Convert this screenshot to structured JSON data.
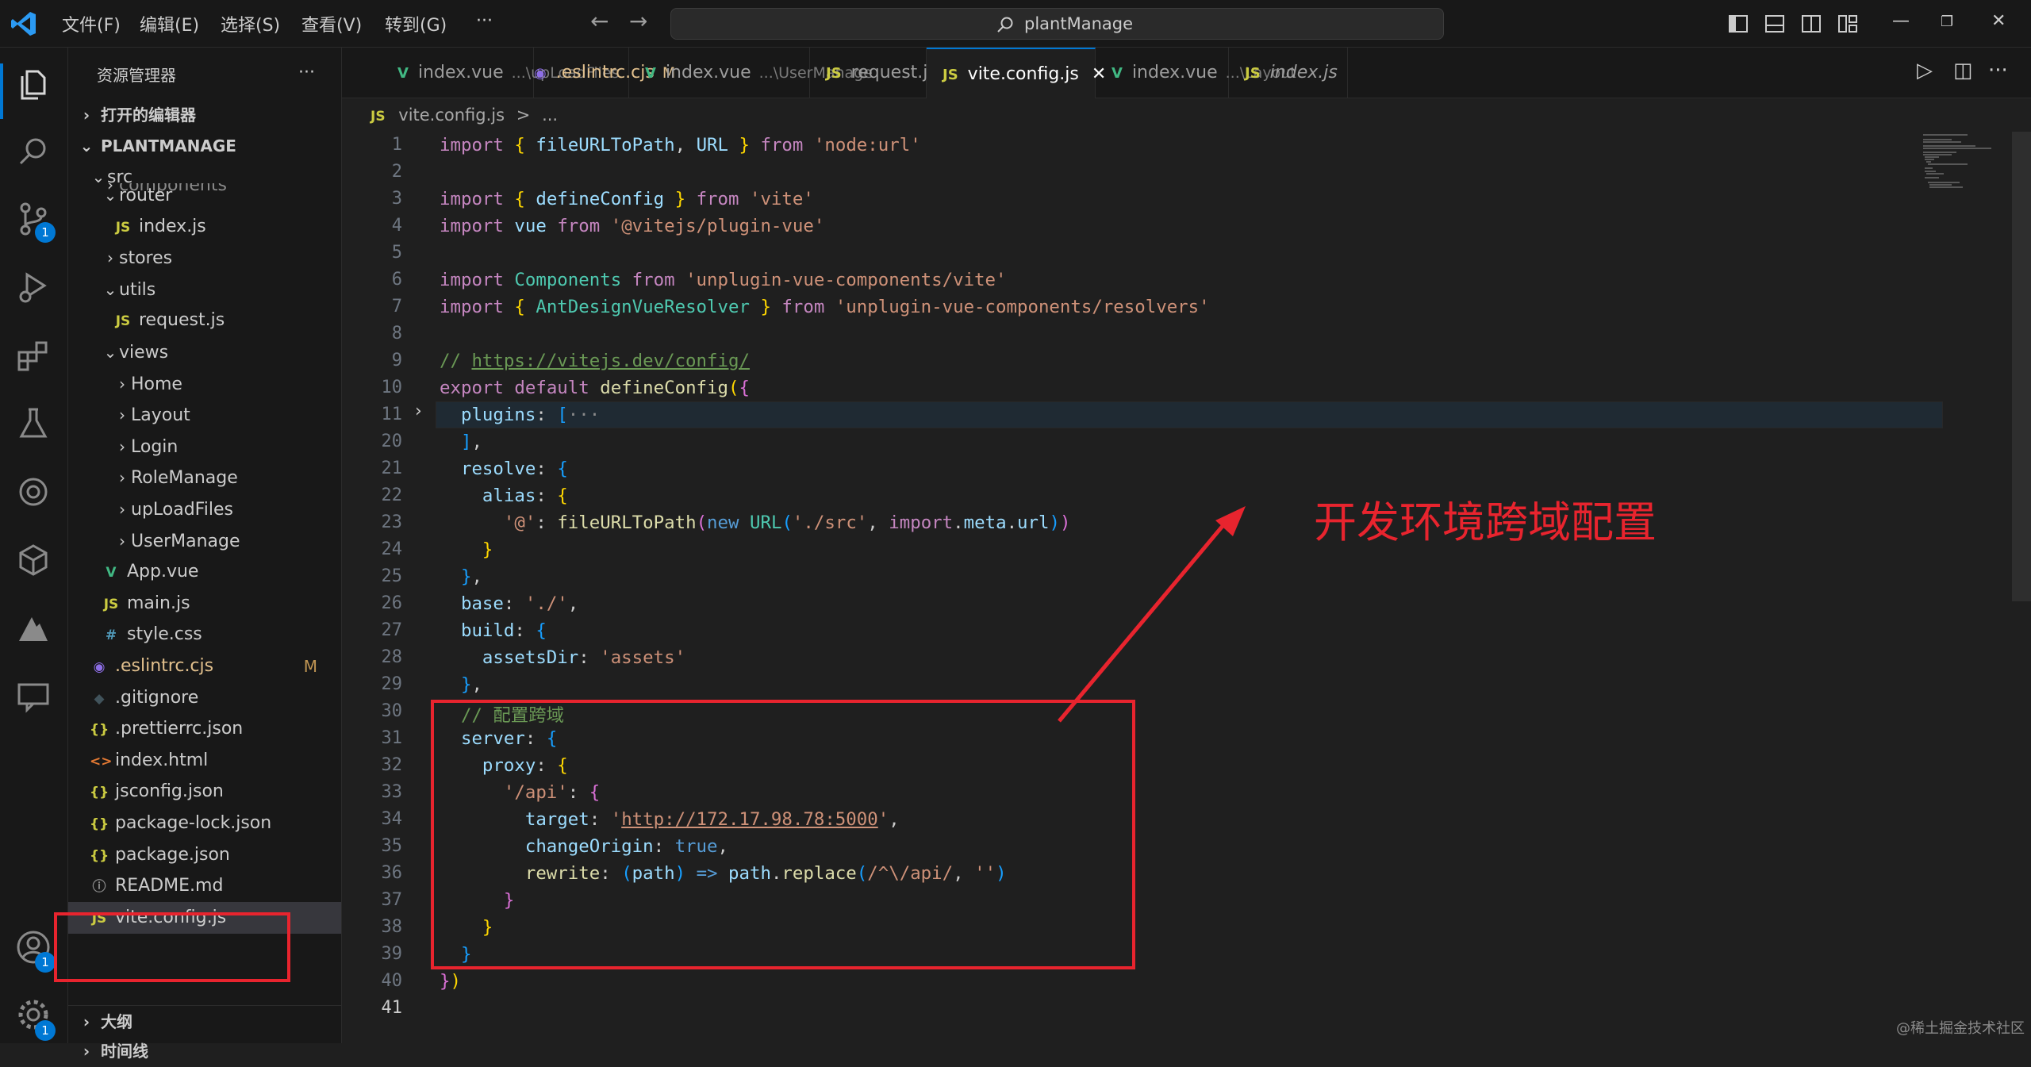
{
  "menu": {
    "items": [
      "文件(F)",
      "编辑(E)",
      "选择(S)",
      "查看(V)",
      "转到(G)"
    ],
    "more": "···"
  },
  "search": {
    "text": "plantManage"
  },
  "activity": {
    "source_control_badge": "1",
    "accounts_badge": "1",
    "settings_badge": "1"
  },
  "sidebar": {
    "title": "资源管理器",
    "more": "···",
    "open_editors": "打开的编辑器",
    "project": "PLANTMANAGE",
    "tree": [
      {
        "label": "src",
        "type": "folder-open"
      },
      {
        "label": "components",
        "type": "folder"
      },
      {
        "label": "router",
        "type": "folder-open"
      },
      {
        "label": "index.js",
        "type": "js"
      },
      {
        "label": "stores",
        "type": "folder"
      },
      {
        "label": "utils",
        "type": "folder-open"
      },
      {
        "label": "request.js",
        "type": "js"
      },
      {
        "label": "views",
        "type": "folder-open"
      },
      {
        "label": "Home",
        "type": "folder"
      },
      {
        "label": "Layout",
        "type": "folder"
      },
      {
        "label": "Login",
        "type": "folder"
      },
      {
        "label": "RoleManage",
        "type": "folder"
      },
      {
        "label": "upLoadFiles",
        "type": "folder"
      },
      {
        "label": "UserManage",
        "type": "folder"
      },
      {
        "label": "App.vue",
        "type": "vue"
      },
      {
        "label": "main.js",
        "type": "js"
      },
      {
        "label": "style.css",
        "type": "css"
      },
      {
        "label": ".eslintrc.cjs",
        "type": "eslint",
        "status": "M"
      },
      {
        "label": ".gitignore",
        "type": "git"
      },
      {
        "label": ".prettierrc.json",
        "type": "json"
      },
      {
        "label": "index.html",
        "type": "html"
      },
      {
        "label": "jsconfig.json",
        "type": "json"
      },
      {
        "label": "package-lock.json",
        "type": "json"
      },
      {
        "label": "package.json",
        "type": "json"
      },
      {
        "label": "README.md",
        "type": "info"
      },
      {
        "label": "vite.config.js",
        "type": "js"
      }
    ],
    "outline": "大纲",
    "timeline": "时间线"
  },
  "tabs": [
    {
      "label": "index.vue",
      "hint": "...\\upLoadFiles",
      "type": "vue"
    },
    {
      "label": ".eslintrc.cjs",
      "hint": "M",
      "type": "eslint"
    },
    {
      "label": "index.vue",
      "hint": "...\\UserManage",
      "type": "vue"
    },
    {
      "label": "request.js",
      "hint": "",
      "type": "js"
    },
    {
      "label": "vite.config.js",
      "hint": "",
      "type": "js",
      "active": true
    },
    {
      "label": "index.vue",
      "hint": "...\\Layout",
      "type": "vue"
    },
    {
      "label": "index.js",
      "hint": "",
      "type": "js"
    }
  ],
  "breadcrumb": {
    "file": "vite.config.js",
    "sep": ">",
    "rest": "..."
  },
  "editor": {
    "line_numbers": [
      "1",
      "2",
      "3",
      "4",
      "5",
      "6",
      "7",
      "8",
      "9",
      "10",
      "11",
      "20",
      "21",
      "22",
      "23",
      "24",
      "25",
      "26",
      "27",
      "28",
      "29",
      "30",
      "31",
      "32",
      "33",
      "34",
      "35",
      "36",
      "37",
      "38",
      "39",
      "40",
      "41"
    ],
    "fold_marker": "···"
  },
  "annotation": {
    "text": "开发环境跨域配置",
    "color": "#e8242e"
  },
  "watermark": "@稀土掘金技术社区",
  "colors": {
    "accent": "#0078d4",
    "annotation": "#e8242e"
  }
}
